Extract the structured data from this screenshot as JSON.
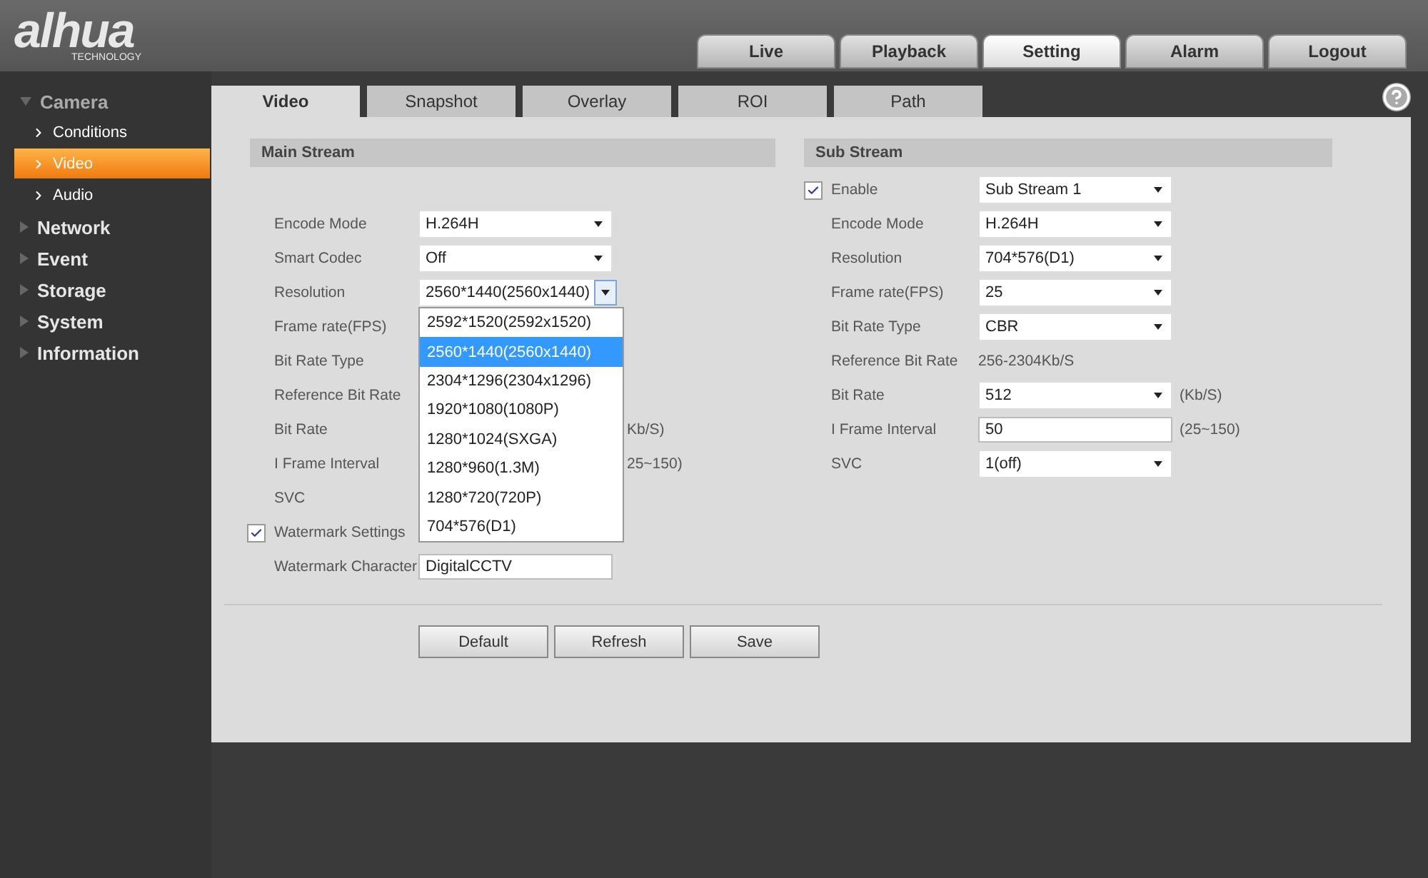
{
  "logo": {
    "wordmark": "alhua",
    "tagline": "TECHNOLOGY"
  },
  "top_tabs": [
    {
      "label": "Live",
      "selected": false
    },
    {
      "label": "Playback",
      "selected": false
    },
    {
      "label": "Setting",
      "selected": true
    },
    {
      "label": "Alarm",
      "selected": false
    },
    {
      "label": "Logout",
      "selected": false
    }
  ],
  "sidebar": {
    "items": [
      {
        "label": "Camera",
        "expanded": true,
        "children": [
          {
            "label": "Conditions",
            "selected": false
          },
          {
            "label": "Video",
            "selected": true
          },
          {
            "label": "Audio",
            "selected": false
          }
        ]
      },
      {
        "label": "Network",
        "expanded": false
      },
      {
        "label": "Event",
        "expanded": false
      },
      {
        "label": "Storage",
        "expanded": false
      },
      {
        "label": "System",
        "expanded": false
      },
      {
        "label": "Information",
        "expanded": false
      }
    ]
  },
  "sub_tabs": [
    {
      "label": "Video",
      "selected": true
    },
    {
      "label": "Snapshot",
      "selected": false
    },
    {
      "label": "Overlay",
      "selected": false
    },
    {
      "label": "ROI",
      "selected": false
    },
    {
      "label": "Path",
      "selected": false
    }
  ],
  "main_stream": {
    "title": "Main Stream",
    "rows": [
      {
        "kind": "select",
        "label": "Encode Mode",
        "value": "H.264H"
      },
      {
        "kind": "select",
        "label": "Smart Codec",
        "value": "Off"
      },
      {
        "kind": "dropdown",
        "label": "Resolution",
        "value": "2560*1440(2560x1440)",
        "options": [
          {
            "label": "2592*1520(2592x1520)",
            "selected": false
          },
          {
            "label": "2560*1440(2560x1440)",
            "selected": true
          },
          {
            "label": "2304*1296(2304x1296)",
            "selected": false
          },
          {
            "label": "1920*1080(1080P)",
            "selected": false
          },
          {
            "label": "1280*1024(SXGA)",
            "selected": false
          },
          {
            "label": "1280*960(1.3M)",
            "selected": false
          },
          {
            "label": "1280*720(720P)",
            "selected": false
          },
          {
            "label": "704*576(D1)",
            "selected": false
          }
        ]
      },
      {
        "kind": "hidden",
        "label": "Frame rate(FPS)"
      },
      {
        "kind": "hidden",
        "label": "Bit Rate Type"
      },
      {
        "kind": "hidden",
        "label": "Reference Bit Rate"
      },
      {
        "kind": "hidden",
        "label": "Bit Rate",
        "unit": "Kb/S)"
      },
      {
        "kind": "hidden",
        "label": "I Frame Interval",
        "unit": "25~150)"
      },
      {
        "kind": "hidden",
        "label": "SVC"
      },
      {
        "kind": "checkbox",
        "label": "Watermark Settings",
        "checked": true
      },
      {
        "kind": "input",
        "label": "Watermark Character",
        "value": "DigitalCCTV"
      }
    ]
  },
  "sub_stream": {
    "title": "Sub Stream",
    "rows": [
      {
        "kind": "checkselect",
        "label": "Enable",
        "checked": true,
        "value": "Sub Stream 1"
      },
      {
        "kind": "select",
        "label": "Encode Mode",
        "value": "H.264H"
      },
      {
        "kind": "select",
        "label": "Resolution",
        "value": "704*576(D1)"
      },
      {
        "kind": "select",
        "label": "Frame rate(FPS)",
        "value": "25"
      },
      {
        "kind": "select",
        "label": "Bit Rate Type",
        "value": "CBR"
      },
      {
        "kind": "text",
        "label": "Reference Bit Rate",
        "value": "256-2304Kb/S"
      },
      {
        "kind": "select",
        "label": "Bit Rate",
        "value": "512",
        "unit": "(Kb/S)"
      },
      {
        "kind": "input",
        "label": "I Frame Interval",
        "value": "50",
        "unit": "(25~150)"
      },
      {
        "kind": "select",
        "label": "SVC",
        "value": "1(off)"
      }
    ]
  },
  "buttons": [
    "Default",
    "Refresh",
    "Save"
  ]
}
